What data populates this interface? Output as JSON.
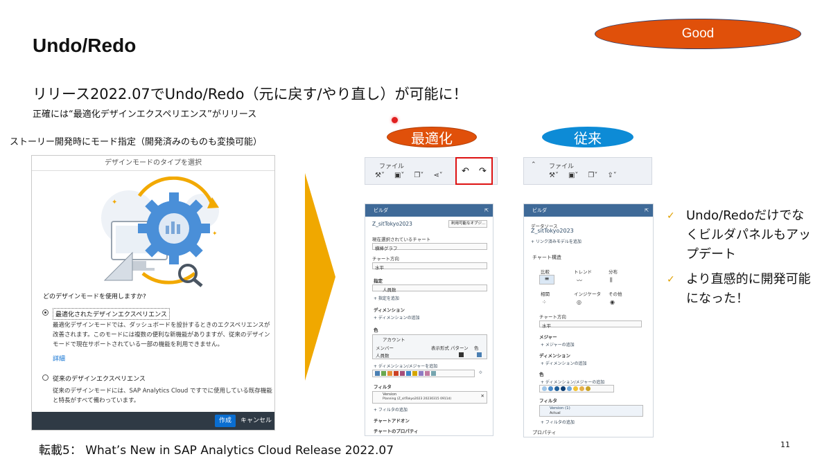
{
  "slide": {
    "title": "Undo/Redo",
    "badge": "Good",
    "headline": "リリース2022.07でUndo/Redo（元に戻す/やり直し）が可能に！",
    "subline": "正確には“最適化デザインエクスペリエンス”がリリース",
    "left_label": "ストーリー開発時にモード指定（開発済みのものも変換可能）",
    "label_optimized": "最適化",
    "label_classic": "従来",
    "footer": "転載5： What’s New in SAP Analytics Cloud Release 2022.07",
    "page_number": "11"
  },
  "dialog": {
    "title": "デザインモードのタイプを選択",
    "question": "どのデザインモードを使用しますか?",
    "option1": "最適化されたデザインエクスペリエンス",
    "option1_desc": "最適化デザインモードでは、ダッシュボードを設計するときのエクスペリエンスが改善されます。このモードには複数の便利な新機能がありますが、従来のデザインモードで現在サポートされている一部の機能を利用できません。",
    "details_link": "詳細",
    "option2": "従来のデザインエクスペリエンス",
    "option2_desc": "従来のデザインモードには、SAP Analytics Cloud ですでに使用している既存機能と特長がすべて備わっています。",
    "create_button": "作成",
    "cancel_button": "キャンセル"
  },
  "toolbar_optimized": {
    "label": "ファイル"
  },
  "toolbar_classic": {
    "label": "ファイル"
  },
  "builder_optimized": {
    "header": "ビルダ",
    "model": "Z_sitTokyo2023",
    "model_button": "利用可能なオブジ...",
    "current_chart_label": "現在選択されているチャート",
    "current_chart_value": "横棒グラフ",
    "orientation_label": "チャート方向",
    "orientation_value": "水平",
    "measures_section": "指定",
    "measure_value": "人員数",
    "add_measure": "+ 指定を追加",
    "dimension_section": "ディメンション",
    "add_dimension": "+ ディメンションの追加",
    "color_section": "色",
    "account_label": "アカウント",
    "member_col": "メンバー",
    "display_col": "表示形式",
    "pattern_col": "パターン",
    "color_col": "色",
    "member_value": "人員数",
    "add_dimension_measure": "+ ディメンション/メジャーを追加",
    "filter_section": "フィルタ",
    "filter_name": "Version",
    "filter_value": "Planning (Z_sitTokyo2023 20230315 0911d)",
    "add_filter": "+ フィルタの追加",
    "chart_addon_section": "チャートアドオン",
    "chart_properties_section": "チャートのプロパティ",
    "palette": [
      "#4a7fb3",
      "#6aa84f",
      "#e69138",
      "#cc4125",
      "#a64d79",
      "#3d85c6",
      "#d5a600",
      "#8e7cc3",
      "#c27ba0",
      "#76a5af"
    ]
  },
  "builder_classic": {
    "header": "ビルダ",
    "datasource_label": "データソース",
    "model": "Z_sitTokyo2023",
    "linked_models": "+ リンク済みモデルを追加",
    "chart_structure": "チャート構造",
    "type_compare": "比較",
    "type_trend": "トレンド",
    "type_distribution": "分布",
    "type_correlation": "相関",
    "type_indicator": "インジケータ",
    "type_other": "その他",
    "orientation_label": "チャート方向",
    "orientation_value": "水平",
    "measures_label": "メジャー",
    "add_measure": "+ メジャーの追加",
    "dimension_label": "ディメンション",
    "add_dimension": "+ ディメンションの追加",
    "color_label": "色",
    "add_dimension_measure": "+ ディメンション/メジャーの追加",
    "filter_label": "フィルタ",
    "filter_name": "Version (1)",
    "filter_value": "Actual",
    "add_filter": "+ フィルタの追加",
    "properties": "プロパティ",
    "palette": [
      "#9fc5e8",
      "#4a8bc9",
      "#1f5f99",
      "#0b3d73",
      "#6fa8dc",
      "#f1c232",
      "#e6b04a",
      "#c9a227"
    ]
  },
  "bullets": [
    "Undo/Redoだけでなくビルダパネルもアップデート",
    "より直感的に開発可能になった！"
  ],
  "colors": {
    "orange": "#e0500a",
    "blue": "#0d8bd6",
    "arrow": "#f0a800",
    "panel_header": "#3f6a98"
  }
}
